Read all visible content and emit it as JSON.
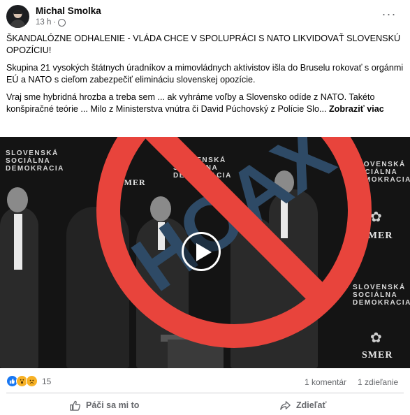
{
  "post": {
    "author": "Michal Smolka",
    "time": "13 h",
    "more_icon": "more-options-icon",
    "paragraphs": [
      "ŠKANDALÓZNE ODHALENIE - VLÁDA CHCE V SPOLUPRÁCI S NATO LIKVIDOVAŤ SLOVENSKÚ OPOZÍCIU!",
      "Skupina 21 vysokých štátnych úradníkov a mimovládnych aktivistov išla do Bruselu rokovať s orgánmi EÚ a NATO s cieľom zabezpečiť elimináciu slovenskej opozície.",
      "Vraj sme hybridná hrozba a treba sem ... ak vyhráme voľby a Slovensko odíde z NATO. Takéto konšpiračné teórie ... Milo z Ministerstva vnútra či David Púchovský z Polície Slo..."
    ],
    "see_more": "Zobraziť viac"
  },
  "media": {
    "banner_lines": [
      "SLOVENSKÁ",
      "SOCIÁLNA",
      "DEMOKRACIA"
    ],
    "party": "SMER",
    "stamp_text": "HOAX",
    "stamp_color": "#e8443c",
    "stamp_text_color": "#2e4a66"
  },
  "stats": {
    "reaction_count": "15",
    "comments": "1 komentár",
    "shares": "1 zdieľanie"
  },
  "actions": {
    "like": "Páči sa mi to",
    "share": "Zdieľať"
  }
}
